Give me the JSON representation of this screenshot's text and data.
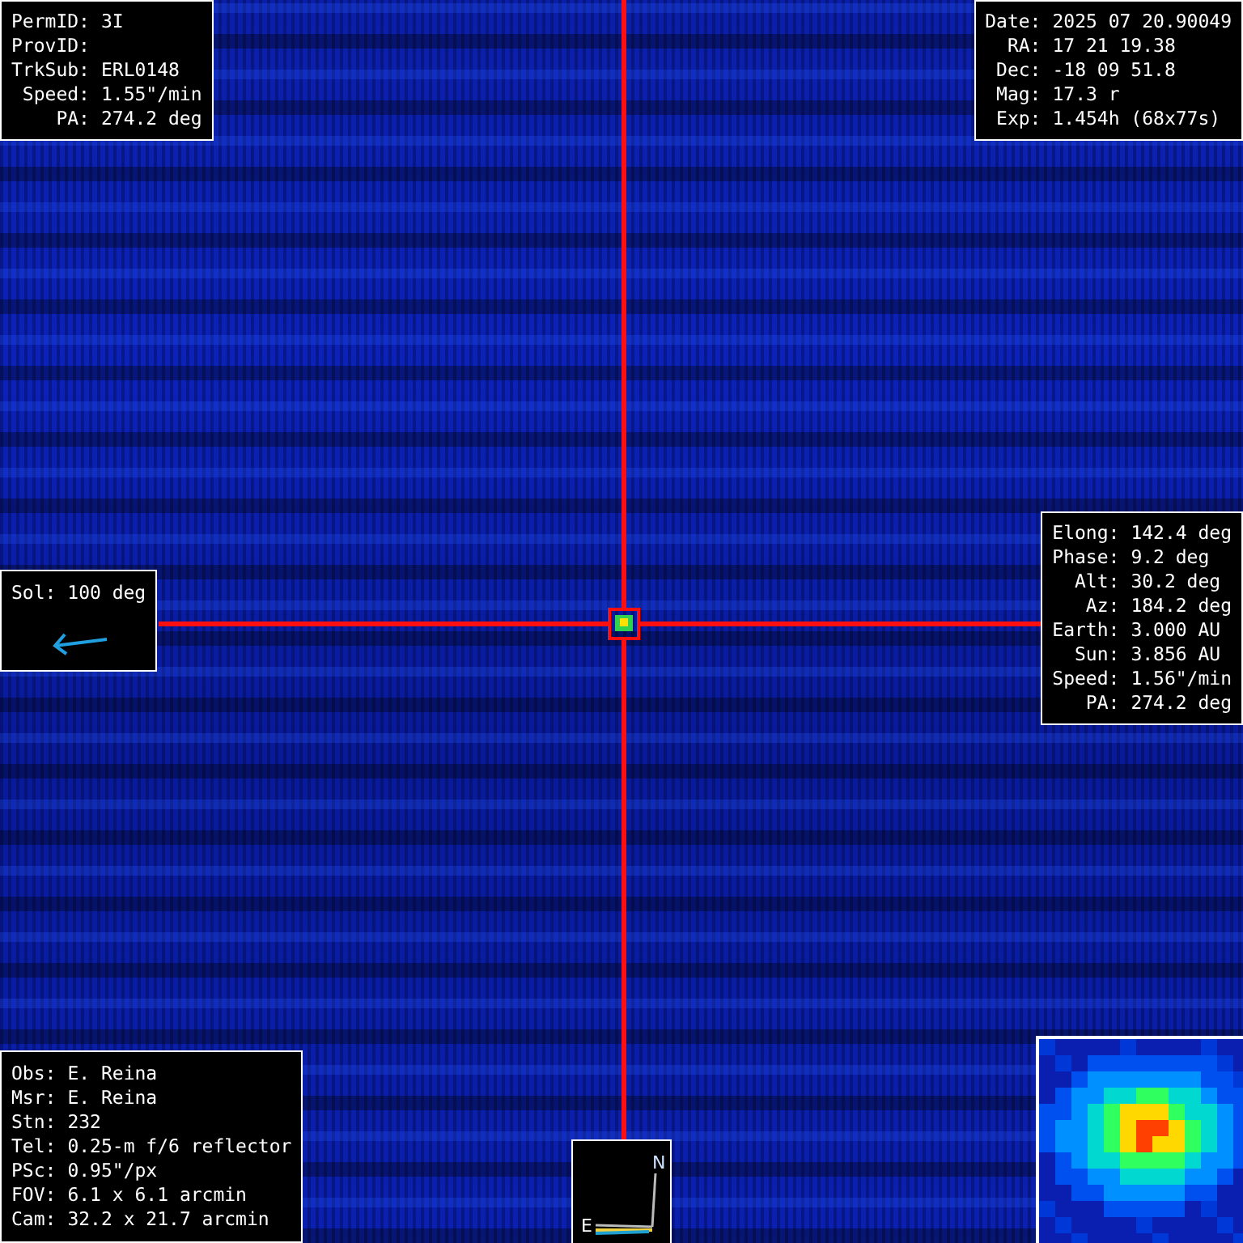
{
  "target_panel": [
    {
      "label": "PermID:",
      "value": "3I"
    },
    {
      "label": "ProvID:"
    },
    {
      "label": "TrkSub:",
      "value": "ERL0148"
    },
    {
      "label": "Speed:",
      "value": "1.55\"/min"
    },
    {
      "label": "PA:",
      "value": "274.2 deg"
    }
  ],
  "position_panel": [
    {
      "label": "Date:",
      "value": "2025 07 20.90049"
    },
    {
      "label": "RA:",
      "value": "17 21 19.38"
    },
    {
      "label": "Dec:",
      "value": "-18 09 51.8"
    },
    {
      "label": "Mag:",
      "value": "17.3 r"
    },
    {
      "label": "Exp:",
      "value": "1.454h (68x77s)"
    }
  ],
  "geometry_panel": [
    {
      "label": "Elong:",
      "value": "142.4 deg"
    },
    {
      "label": "Phase:",
      "value": "9.2 deg"
    },
    {
      "label": "Alt:",
      "value": "30.2 deg"
    },
    {
      "label": "Az:",
      "value": "184.2 deg"
    },
    {
      "label": "Earth:",
      "value": "3.000 AU"
    },
    {
      "label": "Sun:",
      "value": "3.856 AU"
    },
    {
      "label": "Speed:",
      "value": "1.56\"/min"
    },
    {
      "label": "PA:",
      "value": "274.2 deg"
    }
  ],
  "sol_panel": {
    "label": "Sol:",
    "value": "100 deg"
  },
  "observer_panel": [
    {
      "label": "Obs:",
      "value": "E. Reina"
    },
    {
      "label": "Msr:",
      "value": "E. Reina"
    },
    {
      "label": "Stn:",
      "value": "232"
    },
    {
      "label": "Tel:",
      "value": "0.25-m f/6 reflector"
    },
    {
      "label": "PSc:",
      "value": "0.95\"/px"
    },
    {
      "label": "FOV:",
      "value": "6.1 x 6.1 arcmin"
    },
    {
      "label": "Cam:",
      "value": "32.2 x 21.7 arcmin"
    }
  ],
  "compass": {
    "north": "N",
    "east": "E"
  }
}
